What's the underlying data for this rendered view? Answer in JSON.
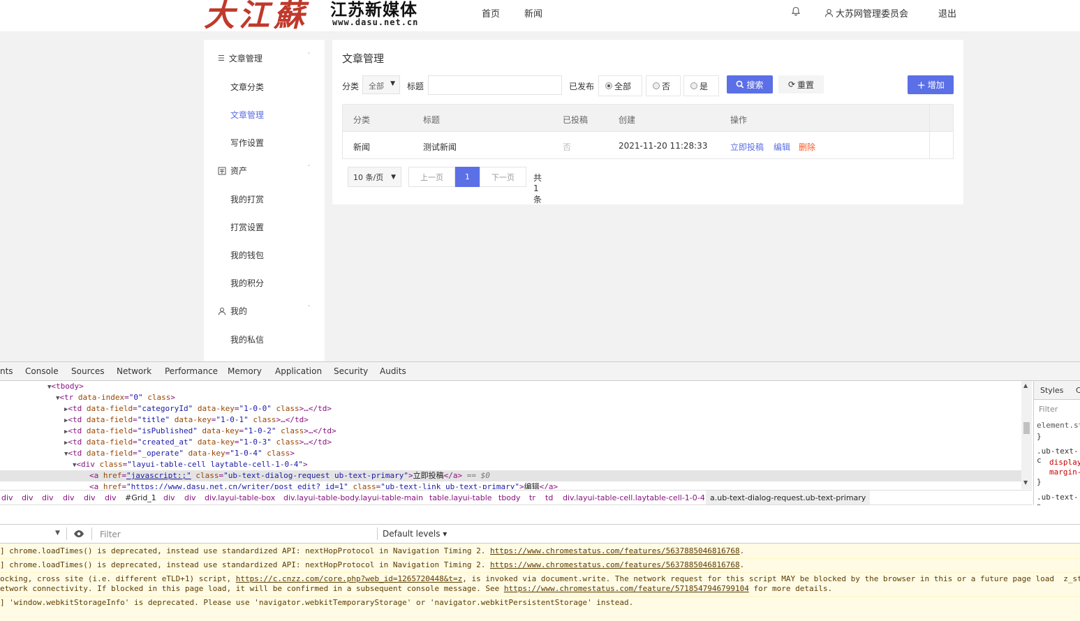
{
  "site": {
    "logo_text": "大江蘇",
    "logo_subtitle": "江苏新媒体",
    "logo_url": "www.dasu.net.cn",
    "nav": [
      "首页",
      "新闻"
    ],
    "user_name": "大苏网管理委员会",
    "logout": "退出",
    "icons": {
      "bell": "bell-icon",
      "user": "user-icon"
    }
  },
  "sidebar": {
    "groups": [
      {
        "label": "文章管理",
        "icon": "list-icon",
        "items": [
          "文章分类",
          "文章管理",
          "写作设置"
        ]
      },
      {
        "label": "资产",
        "icon": "asset-icon",
        "items": [
          "我的打赏",
          "打赏设置",
          "我的钱包",
          "我的积分"
        ]
      },
      {
        "label": "我的",
        "icon": "user-icon",
        "items": [
          "我的私信"
        ]
      }
    ],
    "active_item": "文章管理"
  },
  "main": {
    "title": "文章管理",
    "filters": {
      "category_label": "分类",
      "category_value": "全部",
      "title_label": "标题",
      "title_value": "",
      "published_label": "已发布",
      "published_options": [
        "全部",
        "否",
        "是"
      ],
      "published_selected": "全部",
      "search_button": "搜索",
      "reset_button": "重置",
      "add_button": "增加"
    },
    "table": {
      "headers": [
        "分类",
        "标题",
        "已投稿",
        "创建",
        "操作"
      ],
      "rows": [
        {
          "category": "新闻",
          "title": "测试新闻",
          "submitted": "否",
          "created": "2021-11-20 11:28:33",
          "actions": [
            "立即投稿",
            "编辑",
            "删除"
          ]
        }
      ]
    },
    "pager": {
      "page_size": "10 条/页",
      "prev": "上一页",
      "current": "1",
      "next": "下一页",
      "total": "共 1 条"
    }
  },
  "devtools": {
    "tabs": [
      "nts",
      "Console",
      "Sources",
      "Network",
      "Performance",
      "Memory",
      "Application",
      "Security",
      "Audits"
    ],
    "breadcrumbs": [
      "div",
      "div",
      "div",
      "div",
      "div",
      "div",
      "#Grid_1",
      "div",
      "div",
      "div.layui-table-box",
      "div.layui-table-body.layui-table-main",
      "table.layui-table",
      "tbody",
      "tr",
      "td",
      "div.layui-table-cell.laytable-cell-1-0-4",
      "a.ub-text-dialog-request.ub-text-primary"
    ],
    "styles_tabs": [
      "Styles",
      "C"
    ],
    "styles_filter": "Filter",
    "styles_lines": [
      "element.st",
      "}",
      ".ub-text-c",
      "display",
      "margin-",
      "}",
      ".ub-text-p"
    ],
    "console_filter_placeholder": "Filter",
    "console_levels": "Default levels ▾",
    "messages": [
      {
        "text": "] chrome.loadTimes() is deprecated, instead use standardized API: nextHopProtocol in Navigation Timing 2. ",
        "link": "https://www.chromestatus.com/features/5637885046816768",
        "after": "."
      },
      {
        "text": "] chrome.loadTimes() is deprecated, instead use standardized API: nextHopProtocol in Navigation Timing 2. ",
        "link": "https://www.chromestatus.com/features/5637885046816768",
        "after": "."
      },
      {
        "text": "ocking, cross site (i.e. different eTLD+1) script, ",
        "link": "https://c.cnzz.com/core.php?web_id=1265720448&t=z",
        "after": ", is invoked via document.write. The network request for this script MAY be blocked by the browser in this or a future page load  z_stat"
      },
      {
        "text": "etwork connectivity. If blocked in this page load, it will be confirmed in a subsequent console message. See ",
        "link": "https://www.chromestatus.com/feature/5718547946799104",
        "after": " for more details."
      },
      {
        "text": "] 'window.webkitStorageInfo' is deprecated. Please use 'navigator.webkitTemporaryStorage' or 'navigator.webkitPersistentStorage' instead.",
        "link": "",
        "after": ""
      }
    ]
  }
}
